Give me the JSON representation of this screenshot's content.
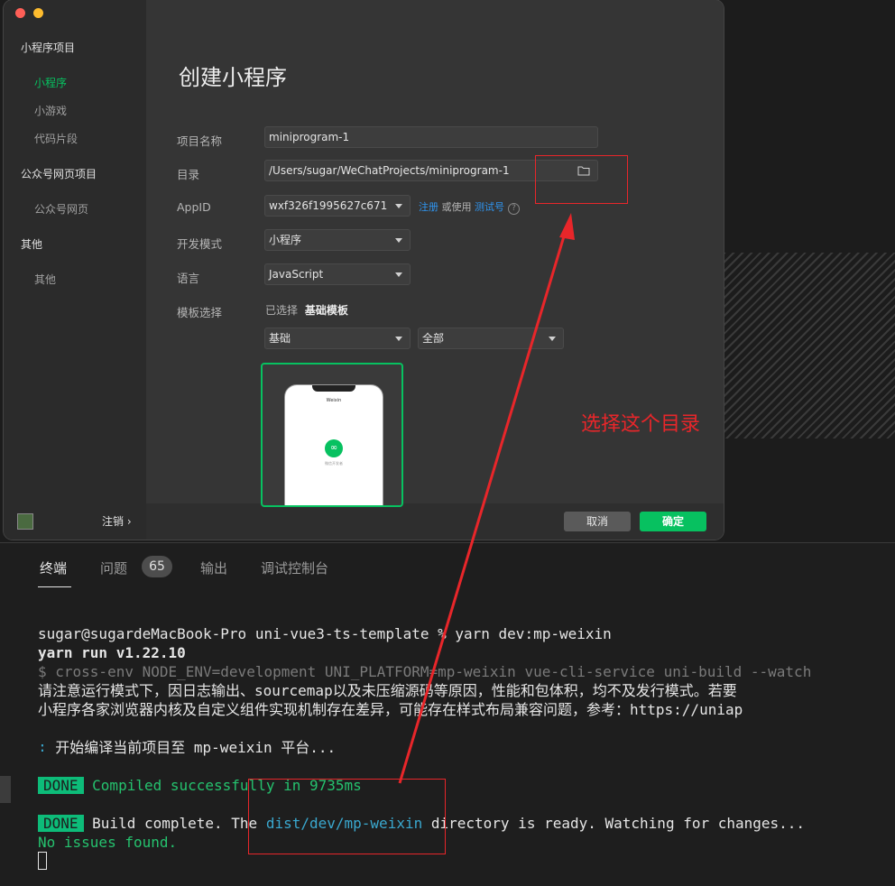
{
  "dialog": {
    "sidebar": {
      "groups": [
        {
          "title": "小程序项目",
          "items": [
            "小程序",
            "小游戏",
            "代码片段"
          ]
        },
        {
          "title": "公众号网页项目",
          "items": [
            "公众号网页"
          ]
        },
        {
          "title": "其他",
          "items": [
            "其他"
          ]
        }
      ],
      "logout_label": "注销 ›"
    },
    "title": "创建小程序",
    "form": {
      "project_name_label": "项目名称",
      "project_name_value": "miniprogram-1",
      "directory_label": "目录",
      "directory_value": "/Users/sugar/WeChatProjects/miniprogram-1",
      "appid_label": "AppID",
      "appid_value": "wxf326f1995627c671",
      "appid_register": "注册",
      "appid_or_use": " 或使用 ",
      "appid_test": "测试号",
      "appid_help": "?",
      "dev_mode_label": "开发模式",
      "dev_mode_value": "小程序",
      "language_label": "语言",
      "language_value": "JavaScript",
      "template_label": "模板选择",
      "template_selected_prefix": "已选择",
      "template_selected_value": "基础模板",
      "template_category_value": "基础",
      "template_filter_value": "全部",
      "preview_phone_title": "Weixin",
      "preview_phone_caption": "微信开发者"
    },
    "cancel_label": "取消",
    "ok_label": "确定"
  },
  "annotation": {
    "text": "选择这个目录",
    "color": "#e8262a"
  },
  "terminal": {
    "tabs": [
      "终端",
      "问题",
      "输出",
      "调试控制台"
    ],
    "problems_count": "65",
    "lines": {
      "prompt": "sugar@sugardeMacBook-Pro uni-vue3-ts-template % yarn dev:mp-weixin",
      "yarn_run": "yarn run v1.22.10",
      "command": "$ cross-env NODE_ENV=development UNI_PLATFORM=mp-weixin vue-cli-service uni-build --watch",
      "notice1": "请注意运行模式下，因日志输出、sourcemap以及未压缩源码等原因，性能和包体积，均不及发行模式。若要",
      "notice2": "小程序各家浏览器内核及自定义组件实现机制存在差异，可能存在样式布局兼容问题，参考：https://uniap",
      "compiling_icon": "∶",
      "compiling": " 开始编译当前项目至 mp-weixin 平台...",
      "done_badge": "DONE",
      "compiled": " Compiled successfully in 9735ms",
      "build_prefix": " Build complete. The ",
      "build_path": "dist/dev/mp-weixin",
      "build_suffix": " directory is ready. Watching for changes...",
      "no_issues": "No issues found."
    }
  },
  "colors": {
    "accent": "#07c160",
    "link": "#2f95f0",
    "terminal_green": "#25c26e",
    "terminal_cyan": "#3aa8cf"
  }
}
